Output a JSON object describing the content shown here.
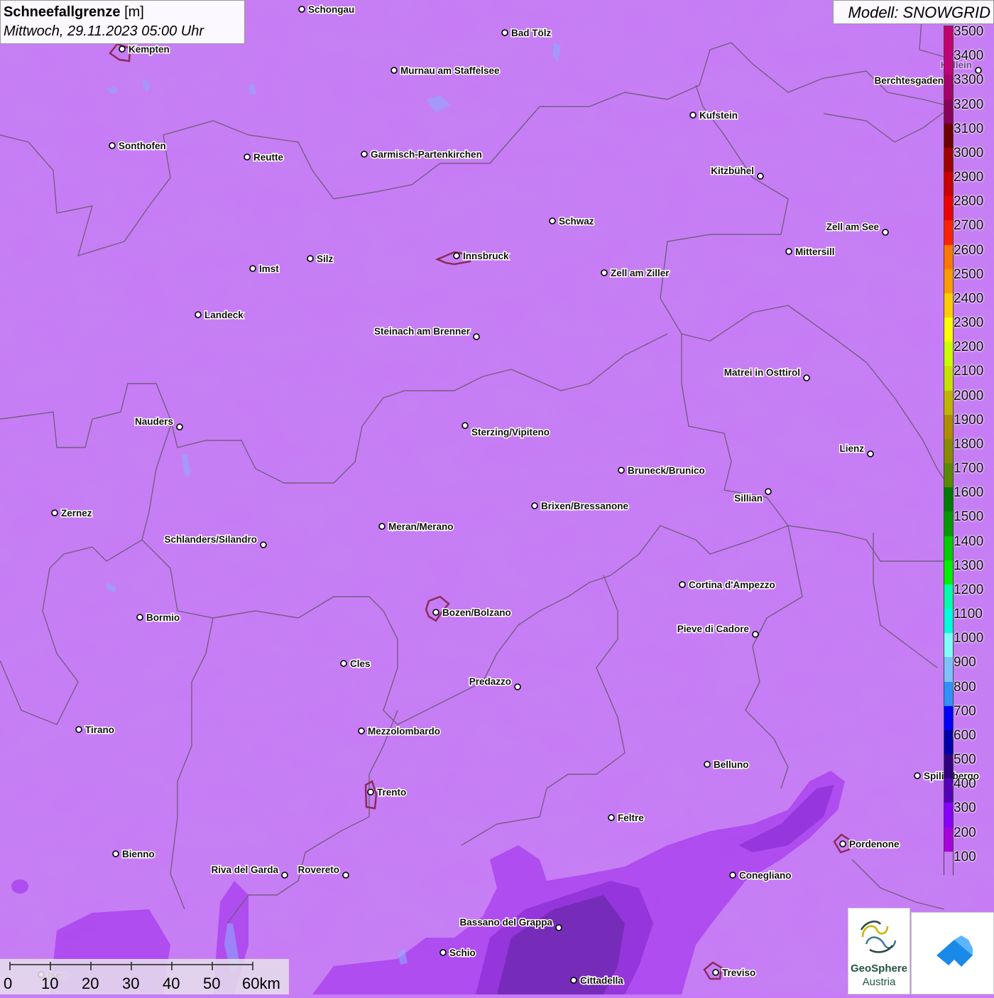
{
  "title": {
    "label": "Schneefallgrenze",
    "unit": "[m]",
    "datetime": "Mittwoch, 29.11.2023 05:00 Uhr"
  },
  "model": "Modell: SNOWGRID",
  "legend": {
    "values": [
      "3500",
      "3400",
      "3300",
      "3200",
      "3100",
      "3000",
      "2900",
      "2800",
      "2700",
      "2600",
      "2500",
      "2400",
      "2300",
      "2200",
      "2100",
      "2000",
      "1900",
      "1800",
      "1700",
      "1600",
      "1500",
      "1400",
      "1300",
      "1200",
      "1100",
      "1000",
      "900",
      "800",
      "700",
      "600",
      "500",
      "400",
      "300",
      "200",
      "100"
    ],
    "colors": [
      "#c4006e",
      "#c2007a",
      "#a8006a",
      "#8a005a",
      "#6e0000",
      "#a00000",
      "#cc0000",
      "#ee0000",
      "#ff2200",
      "#ff7700",
      "#ff9900",
      "#ffcc00",
      "#ffff00",
      "#ccff00",
      "#c8e000",
      "#c0b400",
      "#b08a00",
      "#8a8a00",
      "#5a8a00",
      "#007a00",
      "#009900",
      "#00cc00",
      "#00ee00",
      "#00ffaa",
      "#00ffdd",
      "#80ffff",
      "#80c0ff",
      "#3090ff",
      "#0000ff",
      "#0000aa",
      "#300080",
      "#5500bb",
      "#8800ff",
      "#aa00dd",
      "#c77bf6"
    ]
  },
  "places": [
    {
      "name": "Schongau"
    },
    {
      "name": "Bad Tölz"
    },
    {
      "name": "Kempten"
    },
    {
      "name": "Murnau am Staffelsee"
    },
    {
      "name": "Berchtesgaden"
    },
    {
      "name": "Kufstein"
    },
    {
      "name": "Sonthofen"
    },
    {
      "name": "Reutte"
    },
    {
      "name": "Garmisch-Partenkirchen"
    },
    {
      "name": "Kitzbühel"
    },
    {
      "name": "Schwaz"
    },
    {
      "name": "Zell am See"
    },
    {
      "name": "Mittersill"
    },
    {
      "name": "Innsbruck"
    },
    {
      "name": "Silz"
    },
    {
      "name": "Imst"
    },
    {
      "name": "Zell am Ziller"
    },
    {
      "name": "Landeck"
    },
    {
      "name": "Steinach am Brenner"
    },
    {
      "name": "Matrei in Osttirol"
    },
    {
      "name": "Nauders"
    },
    {
      "name": "Sterzing/Vipiteno"
    },
    {
      "name": "Lienz"
    },
    {
      "name": "Bruneck/Brunico"
    },
    {
      "name": "Sillian"
    },
    {
      "name": "Zernez"
    },
    {
      "name": "Brixen/Bressanone"
    },
    {
      "name": "Meran/Merano"
    },
    {
      "name": "Schlanders/Silandro"
    },
    {
      "name": "Cortina d'Ampezzo"
    },
    {
      "name": "Bozen/Bolzano"
    },
    {
      "name": "Bormio"
    },
    {
      "name": "Pieve di Cadore"
    },
    {
      "name": "Cles"
    },
    {
      "name": "Predazzo"
    },
    {
      "name": "Tirano"
    },
    {
      "name": "Mezzolombardo"
    },
    {
      "name": "Belluno"
    },
    {
      "name": "Spilimbergo"
    },
    {
      "name": "Trento"
    },
    {
      "name": "Feltre"
    },
    {
      "name": "Pordenone"
    },
    {
      "name": "Bienno"
    },
    {
      "name": "Riva del Garda"
    },
    {
      "name": "Rovereto"
    },
    {
      "name": "Conegliano"
    },
    {
      "name": "Bassano del Grappa"
    },
    {
      "name": "Schio"
    },
    {
      "name": "Treviso"
    },
    {
      "name": "Cittadella"
    },
    {
      "name": "Hallein"
    },
    {
      "name": "Iseo"
    }
  ],
  "scale": {
    "labels": [
      "0",
      "10",
      "20",
      "30",
      "40",
      "50",
      "60km"
    ]
  },
  "logos": {
    "geosphere_line1": "GeoSphere",
    "geosphere_line2": "Austria"
  },
  "colors": {
    "base": "#c77bf6",
    "border": "#6b5a78",
    "city_outline": "#8b2b5c",
    "low_zone_1": "#aa44ee",
    "low_zone_2": "#8f32d8",
    "low_zone_3": "#6e2ab0"
  }
}
